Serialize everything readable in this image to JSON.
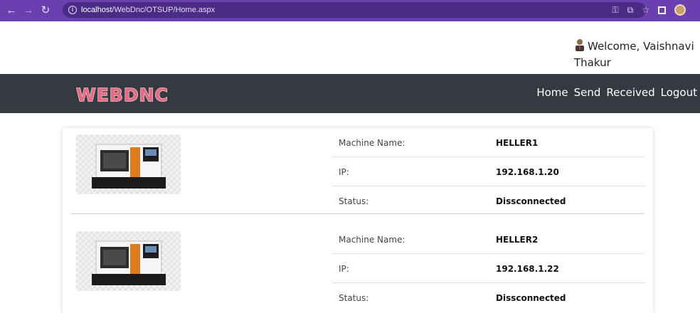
{
  "browser": {
    "url_host": "localhost",
    "url_path": "/WebDnc/OTSUP/Home.aspx",
    "icons": [
      "back-icon",
      "forward-icon",
      "reload-icon",
      "info-icon",
      "key-icon",
      "share-icon",
      "star-icon",
      "window-icon",
      "profile-icon"
    ]
  },
  "header": {
    "welcome_text": "Welcome, Vaishnavi Thakur",
    "logo_text": "WEBDNC"
  },
  "nav": {
    "items": [
      "Home",
      "Send",
      "Received",
      "Logout"
    ]
  },
  "machines": [
    {
      "fields": [
        {
          "label": "Machine Name:",
          "value": "HELLER1"
        },
        {
          "label": "IP:",
          "value": "192.168.1.20"
        },
        {
          "label": "Status:",
          "value": "Dissconnected"
        }
      ]
    },
    {
      "fields": [
        {
          "label": "Machine Name:",
          "value": "HELLER2"
        },
        {
          "label": "IP:",
          "value": "192.168.1.22"
        },
        {
          "label": "Status:",
          "value": "Dissconnected"
        }
      ]
    }
  ],
  "colors": {
    "browser_chrome": "#6a3fb0",
    "navbar": "#343a40",
    "logo": "#e26b86"
  }
}
